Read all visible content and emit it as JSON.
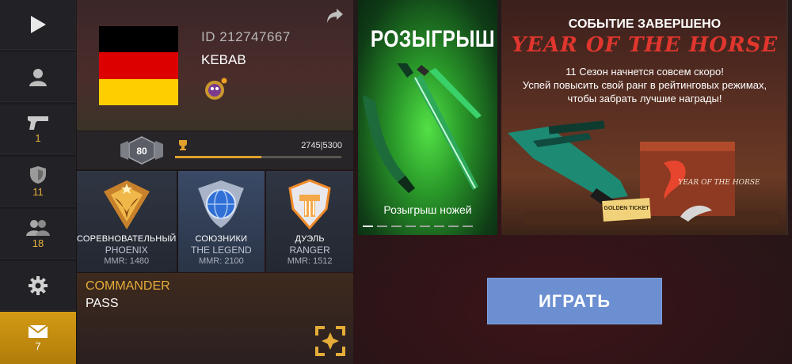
{
  "sidebar": {
    "items": [
      {
        "icon": "play-icon",
        "count": ""
      },
      {
        "icon": "profile-icon",
        "count": ""
      },
      {
        "icon": "pistol-icon",
        "count": "1"
      },
      {
        "icon": "shield-icon",
        "count": "11"
      },
      {
        "icon": "friends-icon",
        "count": "18"
      },
      {
        "icon": "gear-icon",
        "count": ""
      },
      {
        "icon": "mail-icon",
        "count": "7"
      }
    ]
  },
  "profile": {
    "id": "ID 212747667",
    "name": "KEBAB",
    "flag_colors": [
      "#000000",
      "#dd0000",
      "#ffce00"
    ],
    "level": "80",
    "xp_text": "2745|5300",
    "xp_fraction": 0.518
  },
  "modes": [
    {
      "name": "СОРЕВНОВАТЕЛЬНЫЙ",
      "rank": "PHOENIX",
      "mmr": "MMR: 1480"
    },
    {
      "name": "СОЮЗНИКИ",
      "rank": "THE LEGEND",
      "mmr": "MMR: 2100"
    },
    {
      "name": "ДУЭЛЬ",
      "rank": "RANGER",
      "mmr": "MMR: 1512"
    }
  ],
  "commander_pass": {
    "line1": "COMMANDER",
    "line2": "PASS"
  },
  "raffle": {
    "title": "РОЗЫГРЫШ",
    "subtitle": "Розыгрыш ножей",
    "slides": 8,
    "active_slide": 0
  },
  "event": {
    "title": "СОБЫТИЕ ЗАВЕРШЕНО",
    "logo": "YEAR OF THE HORSE",
    "line1": "11 Сезон начнется совсем скоро!",
    "line2": "Успей повысить свой ранг в рейтинговых режимах,",
    "line3": "чтобы забрать лучшие награды!",
    "ticket": "GOLDEN TICKET",
    "box_logo": "YEAR OF THE HORSE"
  },
  "play_button": "ИГРАТЬ",
  "colors": {
    "accent": "#e1a12d",
    "play": "#6b8fd0",
    "event_red": "#e0362e"
  }
}
